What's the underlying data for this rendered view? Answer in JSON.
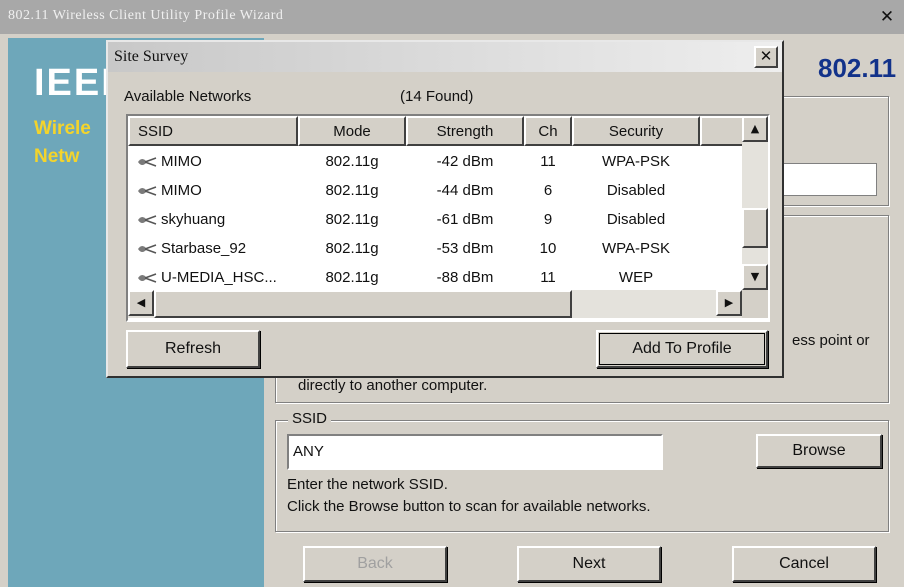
{
  "wizard": {
    "title": "802.11 Wireless Client Utility Profile Wizard",
    "close_glyph": "✕",
    "sidebar": {
      "logo_text": "IEEE",
      "line1": "Wirele",
      "line2": "Netw"
    },
    "header_text": "802.11",
    "mid_text_right": "ess point or",
    "mid_text_bottom": "directly to another computer.",
    "ssid_group": {
      "legend": "SSID",
      "input_value": "ANY",
      "browse_label": "Browse",
      "help1": "Enter the network SSID.",
      "help2": "Click the Browse button to scan for available networks."
    },
    "buttons": {
      "back": "Back",
      "next": "Next",
      "cancel": "Cancel"
    }
  },
  "survey": {
    "title": "Site Survey",
    "close_glyph": "✕",
    "available_label": "Available Networks",
    "found_label": "(14 Found)",
    "columns": [
      "SSID",
      "Mode",
      "Strength",
      "Ch",
      "Security",
      ""
    ],
    "rows": [
      {
        "ssid": "MIMO",
        "mode": "802.11g",
        "strength": "-42 dBm",
        "ch": "11",
        "security": "WPA-PSK"
      },
      {
        "ssid": "MIMO",
        "mode": "802.11g",
        "strength": "-44 dBm",
        "ch": "6",
        "security": "Disabled"
      },
      {
        "ssid": "skyhuang",
        "mode": "802.11g",
        "strength": "-61 dBm",
        "ch": "9",
        "security": "Disabled"
      },
      {
        "ssid": "Starbase_92",
        "mode": "802.11g",
        "strength": "-53 dBm",
        "ch": "10",
        "security": "WPA-PSK"
      },
      {
        "ssid": "U-MEDIA_HSC...",
        "mode": "802.11g",
        "strength": "-88 dBm",
        "ch": "11",
        "security": "WEP"
      }
    ],
    "scroll": {
      "up": "▲",
      "down": "▼",
      "left": "◀",
      "right": "▶"
    },
    "refresh_label": "Refresh",
    "add_profile_label": "Add To Profile"
  },
  "colors": {
    "sidebar": "#6ea7ba",
    "header_blue": "#12328a",
    "sidebar_yellow": "#f4d42b",
    "dialog_face": "#d4d0c8"
  },
  "icons": {
    "network": "wireless-network-icon"
  }
}
